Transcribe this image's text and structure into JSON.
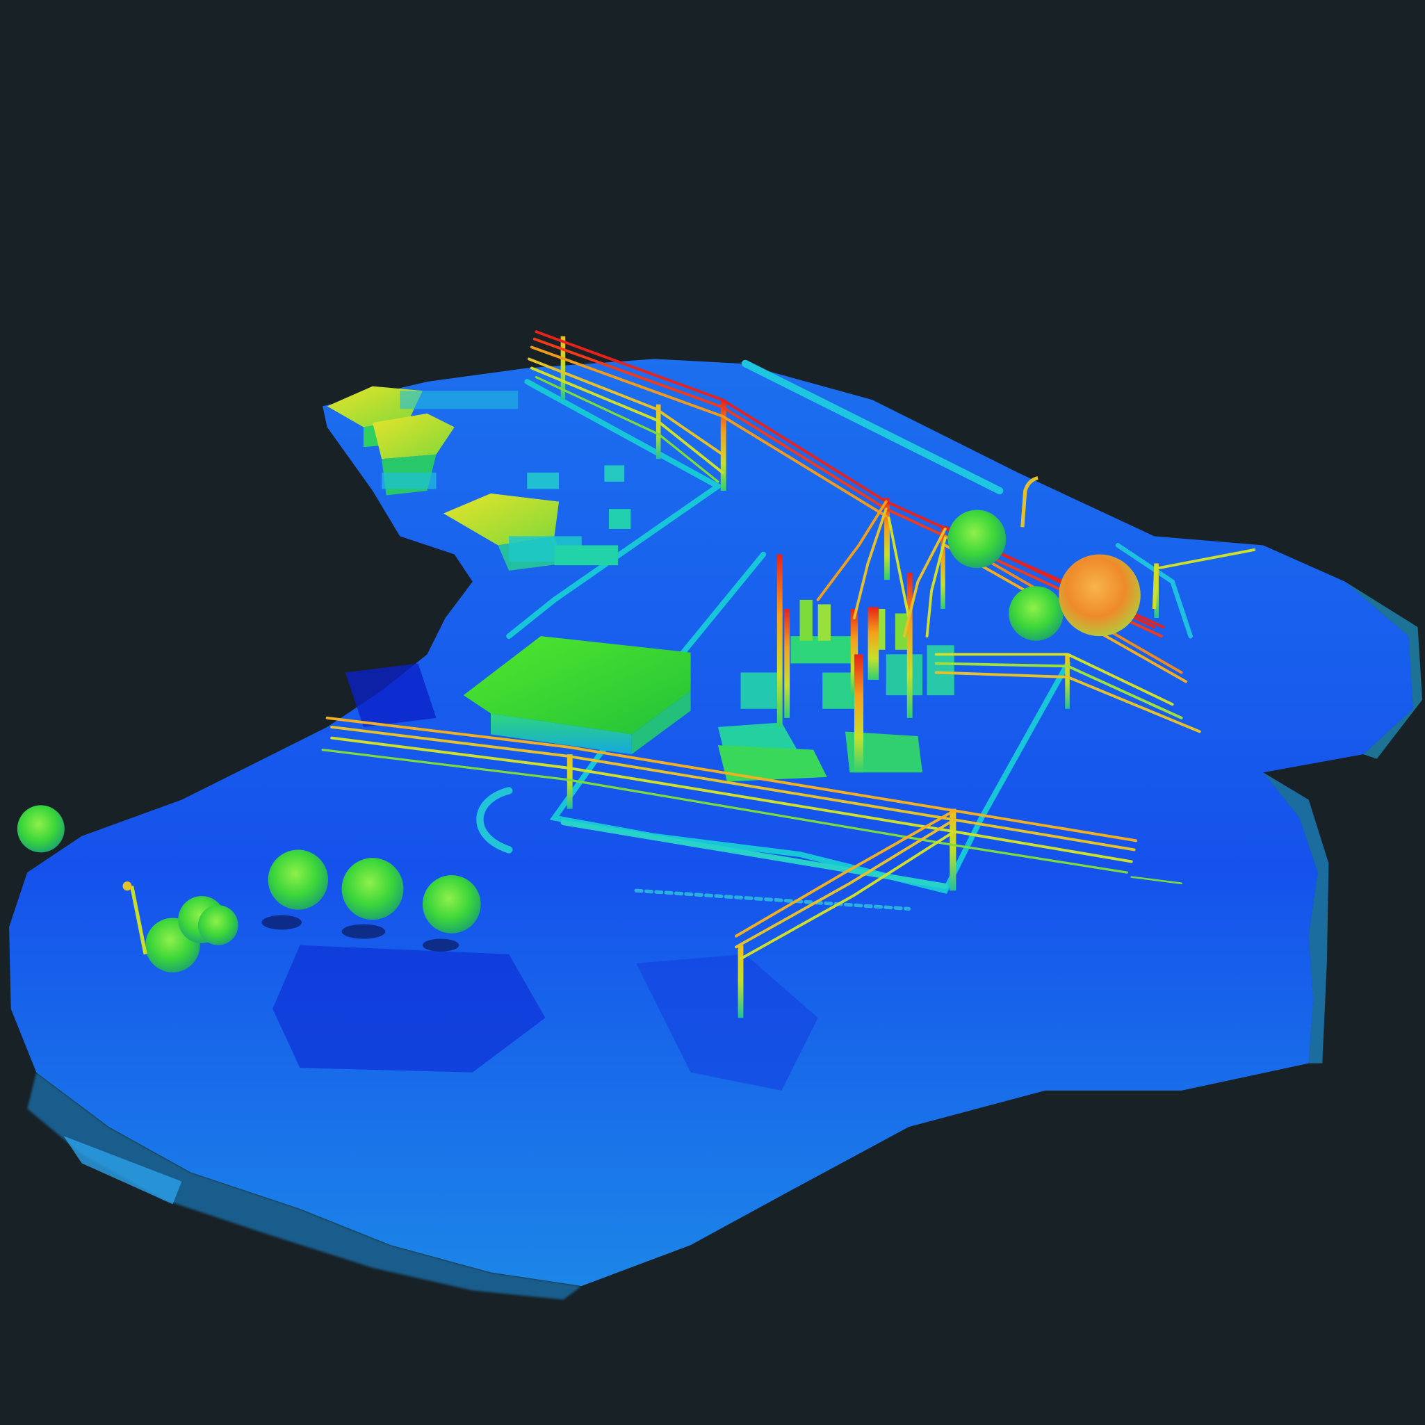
{
  "scene": {
    "kind": "lidar-point-cloud",
    "colormap": "elevation-jet",
    "colors": {
      "background": "#172126",
      "ground_low": "#0a2ad8",
      "ground": "#1a55f0",
      "ground_edge": "#1f8ff2",
      "mid": "#17c7d8",
      "vegetation": "#3fdc3a",
      "roof": "#45e02c",
      "high": "#e6e22a",
      "higher": "#f59a1a",
      "highest": "#e8221a"
    },
    "objects": [
      "ground-surface",
      "substation",
      "power-lines",
      "utility-poles",
      "warehouse-building",
      "industrial-buildings",
      "trees",
      "roadway",
      "light-pole"
    ]
  }
}
